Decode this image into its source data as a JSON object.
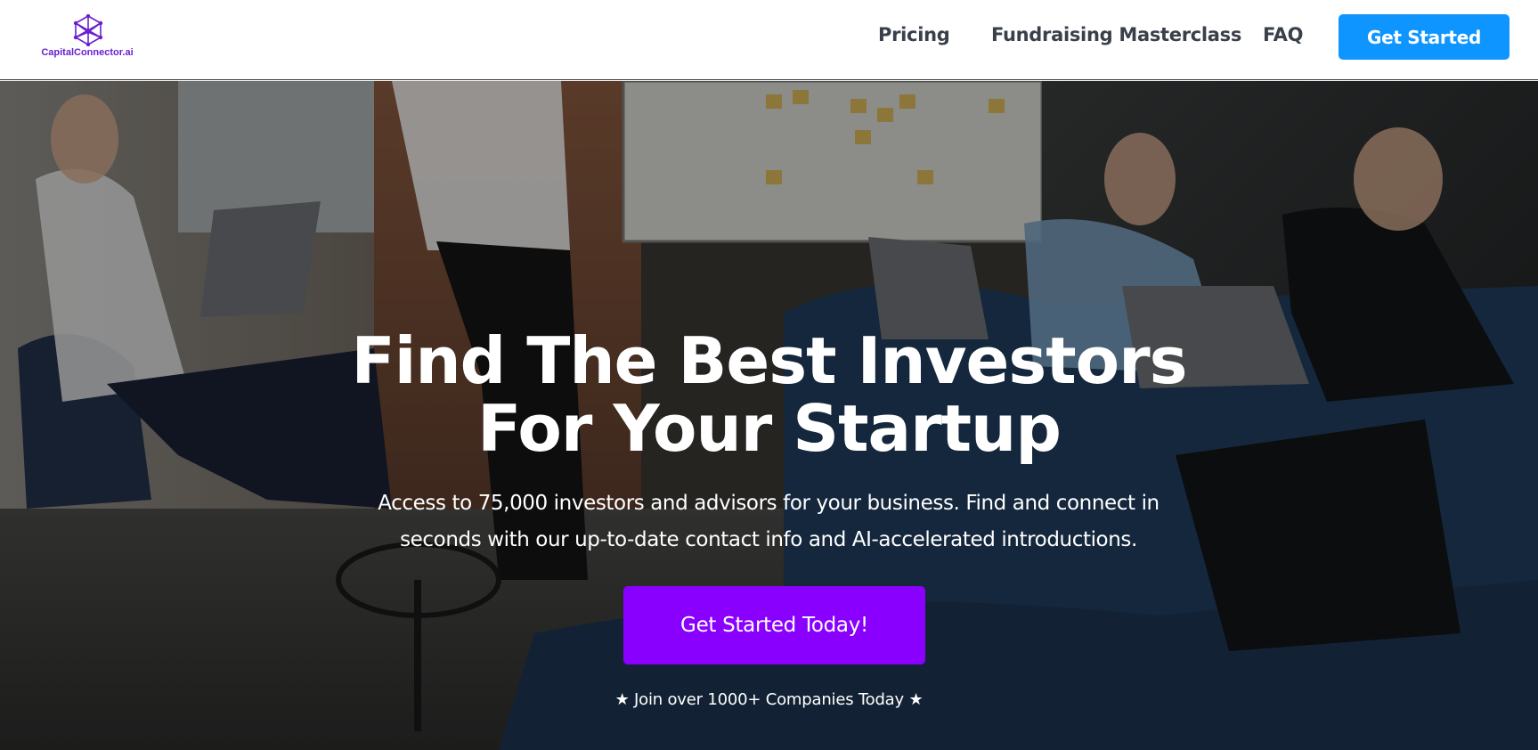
{
  "brand": {
    "name": "CapitalConnector.ai",
    "color": "#6a1fd0"
  },
  "nav": {
    "items": [
      {
        "label": "Pricing"
      },
      {
        "label": "Fundraising Masterclass"
      },
      {
        "label": "FAQ"
      }
    ],
    "cta_label": "Get Started",
    "cta_color": "#0e95ff"
  },
  "hero": {
    "title_line1": "Find The Best Investors",
    "title_line2": "For Your Startup",
    "subtitle_line1": "Access to 75,000 investors and advisors for your business. Find and connect in",
    "subtitle_line2": "seconds with our up-to-date contact info and AI-accelerated introductions.",
    "cta_label": "Get Started Today!",
    "cta_color": "#8a00ff",
    "social_proof": "★ Join over 1000+ Companies Today ★"
  }
}
